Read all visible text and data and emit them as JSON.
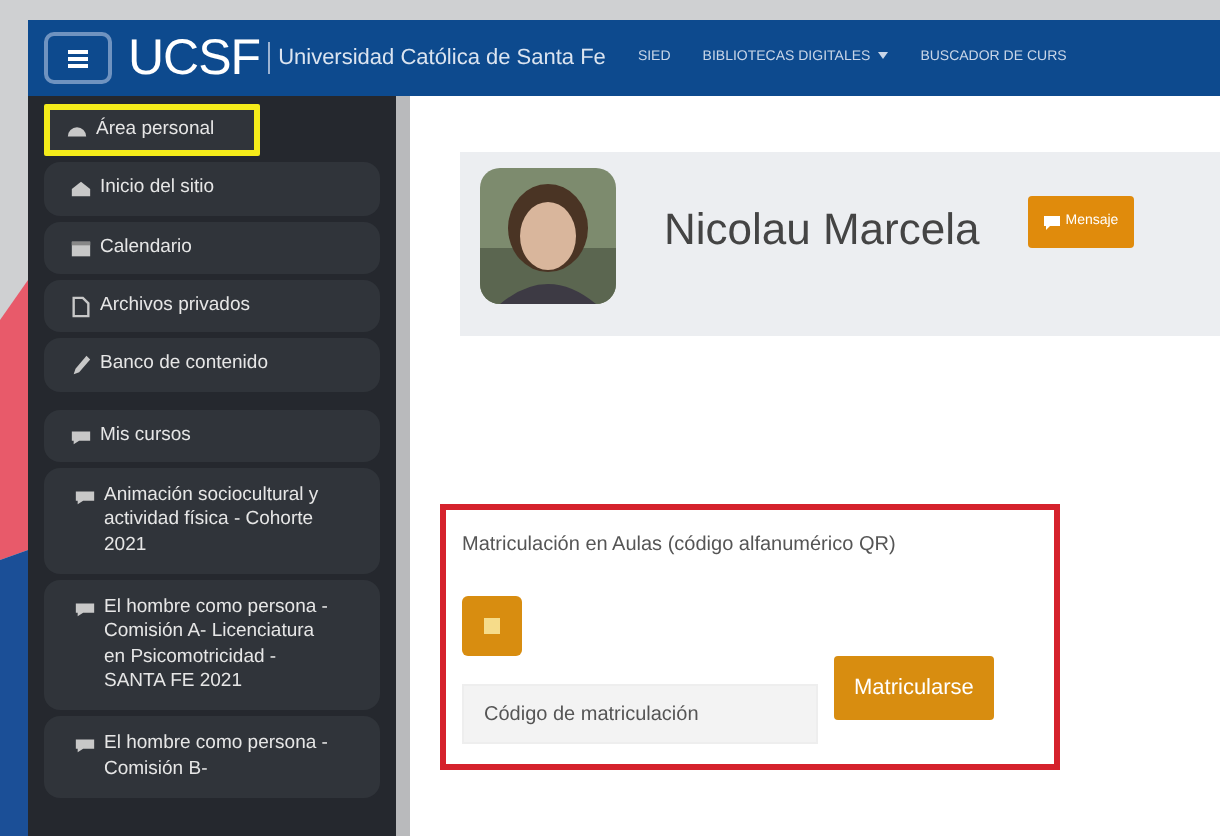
{
  "navbar": {
    "logo": "UCSF",
    "subtitle": "Universidad Católica de Santa Fe",
    "links": [
      {
        "label": "SIED",
        "dropdown": false
      },
      {
        "label": "BIBLIOTECAS DIGITALES",
        "dropdown": true
      },
      {
        "label": "BUSCADOR DE CURS",
        "dropdown": false
      }
    ]
  },
  "sidebar": {
    "items": [
      {
        "label": "Área personal",
        "kind": "dashboard",
        "highlighted": true
      },
      {
        "label": "Inicio del sitio",
        "kind": "home",
        "highlighted": false
      },
      {
        "label": "Calendario",
        "kind": "calendar",
        "highlighted": false
      },
      {
        "label": "Archivos privados",
        "kind": "file",
        "highlighted": false
      },
      {
        "label": "Banco de contenido",
        "kind": "pencil",
        "highlighted": false
      },
      {
        "label": "Mis cursos",
        "kind": "courses",
        "highlighted": false
      },
      {
        "label": "Animación sociocultural y actividad física - Cohorte 2021",
        "kind": "course",
        "highlighted": false
      },
      {
        "label": "El hombre como persona - Comisión A- Licenciatura en Psicomotricidad - SANTA FE 2021",
        "kind": "course",
        "highlighted": false
      },
      {
        "label": "El hombre como persona - Comisión B-",
        "kind": "course",
        "highlighted": false
      }
    ]
  },
  "profile": {
    "name": "Nicolau Marcela",
    "message_button": "Mensaje"
  },
  "enrol": {
    "title": "Matriculación en Aulas (código alfanumérico QR)",
    "placeholder": "Código de matriculación",
    "button": "Matricularse",
    "highlighted": true
  }
}
